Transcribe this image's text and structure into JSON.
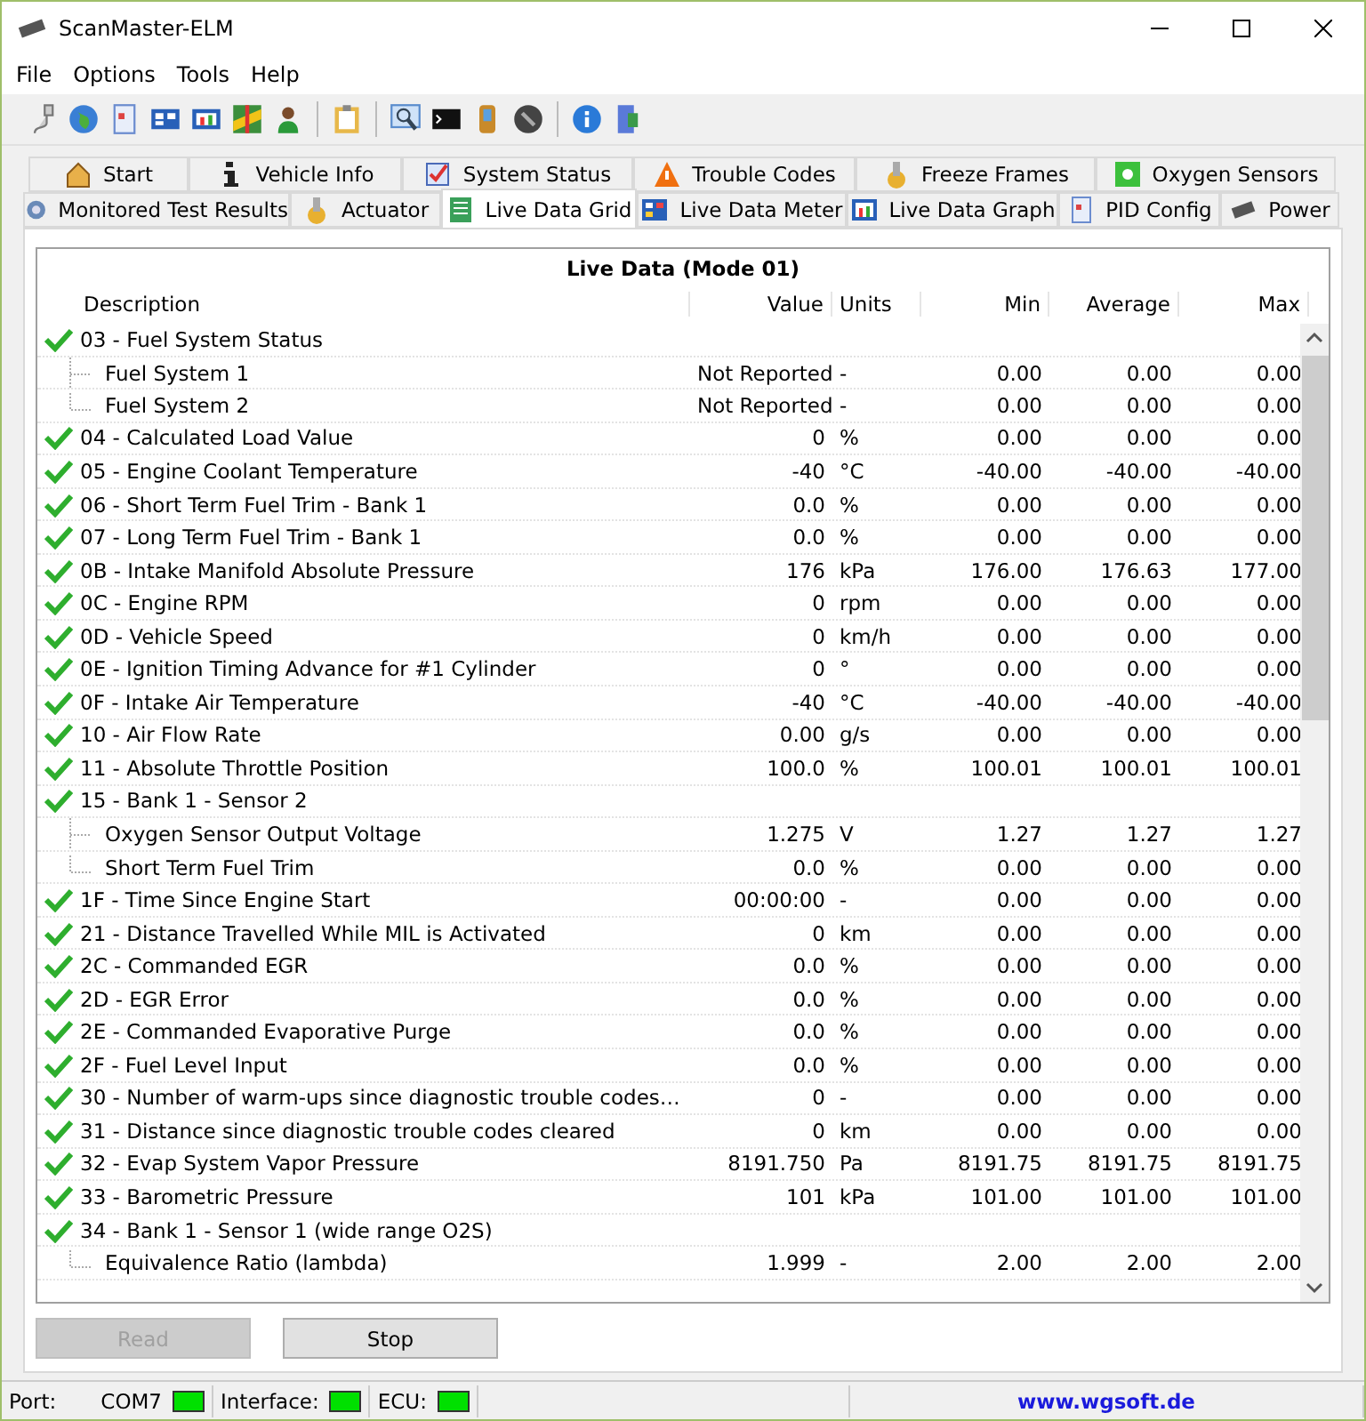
{
  "window": {
    "title": "ScanMaster-ELM"
  },
  "menu": [
    "File",
    "Options",
    "Tools",
    "Help"
  ],
  "tabs_row_1": [
    {
      "label": "Start",
      "selected": false
    },
    {
      "label": "Vehicle Info",
      "selected": false
    },
    {
      "label": "System Status",
      "selected": false
    },
    {
      "label": "Trouble Codes",
      "selected": false
    },
    {
      "label": "Freeze Frames",
      "selected": false
    },
    {
      "label": "Oxygen Sensors",
      "selected": false
    }
  ],
  "tabs_row_2": [
    {
      "label": "Monitored Test Results",
      "selected": false
    },
    {
      "label": "Actuator",
      "selected": false
    },
    {
      "label": "Live Data Grid",
      "selected": true
    },
    {
      "label": "Live Data Meter",
      "selected": false
    },
    {
      "label": "Live Data Graph",
      "selected": false
    },
    {
      "label": "PID Config",
      "selected": false
    },
    {
      "label": "Power",
      "selected": false
    }
  ],
  "grid": {
    "title": "Live Data (Mode 01)",
    "columns": [
      "Description",
      "Value",
      "Units",
      "Min",
      "Average",
      "Max"
    ],
    "rows": [
      {
        "description": "03 - Fuel System Status",
        "checked": true,
        "children": [
          {
            "description": "Fuel System 1",
            "value": "Not Reported",
            "units": "-",
            "min": "0.00",
            "average": "0.00",
            "max": "0.00"
          },
          {
            "description": "Fuel System 2",
            "value": "Not Reported",
            "units": "-",
            "min": "0.00",
            "average": "0.00",
            "max": "0.00"
          }
        ]
      },
      {
        "description": "04 - Calculated Load Value",
        "checked": true,
        "value": "0",
        "units": "%",
        "min": "0.00",
        "average": "0.00",
        "max": "0.00"
      },
      {
        "description": "05 - Engine Coolant Temperature",
        "checked": true,
        "value": "-40",
        "units": "°C",
        "min": "-40.00",
        "average": "-40.00",
        "max": "-40.00"
      },
      {
        "description": "06 - Short Term Fuel Trim - Bank 1",
        "checked": true,
        "value": "0.0",
        "units": "%",
        "min": "0.00",
        "average": "0.00",
        "max": "0.00"
      },
      {
        "description": "07 - Long Term Fuel Trim - Bank 1",
        "checked": true,
        "value": "0.0",
        "units": "%",
        "min": "0.00",
        "average": "0.00",
        "max": "0.00"
      },
      {
        "description": "0B - Intake Manifold Absolute Pressure",
        "checked": true,
        "value": "176",
        "units": "kPa",
        "min": "176.00",
        "average": "176.63",
        "max": "177.00"
      },
      {
        "description": "0C - Engine RPM",
        "checked": true,
        "value": "0",
        "units": "rpm",
        "min": "0.00",
        "average": "0.00",
        "max": "0.00"
      },
      {
        "description": "0D - Vehicle Speed",
        "checked": true,
        "value": "0",
        "units": "km/h",
        "min": "0.00",
        "average": "0.00",
        "max": "0.00"
      },
      {
        "description": "0E - Ignition Timing Advance for #1 Cylinder",
        "checked": true,
        "value": "0",
        "units": "°",
        "min": "0.00",
        "average": "0.00",
        "max": "0.00"
      },
      {
        "description": "0F - Intake Air Temperature",
        "checked": true,
        "value": "-40",
        "units": "°C",
        "min": "-40.00",
        "average": "-40.00",
        "max": "-40.00"
      },
      {
        "description": "10 - Air Flow Rate",
        "checked": true,
        "value": "0.00",
        "units": "g/s",
        "min": "0.00",
        "average": "0.00",
        "max": "0.00"
      },
      {
        "description": "11 - Absolute Throttle Position",
        "checked": true,
        "value": "100.0",
        "units": "%",
        "min": "100.01",
        "average": "100.01",
        "max": "100.01"
      },
      {
        "description": "15 - Bank 1 - Sensor 2",
        "checked": true,
        "children": [
          {
            "description": "Oxygen Sensor Output Voltage",
            "value": "1.275",
            "units": "V",
            "min": "1.27",
            "average": "1.27",
            "max": "1.27"
          },
          {
            "description": "Short Term Fuel Trim",
            "value": "0.0",
            "units": "%",
            "min": "0.00",
            "average": "0.00",
            "max": "0.00"
          }
        ]
      },
      {
        "description": "1F - Time Since Engine Start",
        "checked": true,
        "value": "00:00:00",
        "units": "-",
        "min": "0.00",
        "average": "0.00",
        "max": "0.00"
      },
      {
        "description": "21 - Distance Travelled While MIL is Activated",
        "checked": true,
        "value": "0",
        "units": "km",
        "min": "0.00",
        "average": "0.00",
        "max": "0.00"
      },
      {
        "description": "2C - Commanded EGR",
        "checked": true,
        "value": "0.0",
        "units": "%",
        "min": "0.00",
        "average": "0.00",
        "max": "0.00"
      },
      {
        "description": "2D - EGR Error",
        "checked": true,
        "value": "0.0",
        "units": "%",
        "min": "0.00",
        "average": "0.00",
        "max": "0.00"
      },
      {
        "description": "2E - Commanded Evaporative Purge",
        "checked": true,
        "value": "0.0",
        "units": "%",
        "min": "0.00",
        "average": "0.00",
        "max": "0.00"
      },
      {
        "description": "2F - Fuel Level Input",
        "checked": true,
        "value": "0.0",
        "units": "%",
        "min": "0.00",
        "average": "0.00",
        "max": "0.00"
      },
      {
        "description": "30 - Number of warm-ups since diagnostic trouble codes…",
        "checked": true,
        "value": "0",
        "units": "-",
        "min": "0.00",
        "average": "0.00",
        "max": "0.00"
      },
      {
        "description": "31 - Distance since diagnostic trouble codes cleared",
        "checked": true,
        "value": "0",
        "units": "km",
        "min": "0.00",
        "average": "0.00",
        "max": "0.00"
      },
      {
        "description": "32 - Evap System Vapor Pressure",
        "checked": true,
        "value": "8191.750",
        "units": "Pa",
        "min": "8191.75",
        "average": "8191.75",
        "max": "8191.75"
      },
      {
        "description": "33 - Barometric Pressure",
        "checked": true,
        "value": "101",
        "units": "kPa",
        "min": "101.00",
        "average": "101.00",
        "max": "101.00"
      },
      {
        "description": "34 - Bank 1 - Sensor 1 (wide range O2S)",
        "checked": true,
        "children": [
          {
            "description": "Equivalence Ratio (lambda)",
            "value": "1.999",
            "units": "-",
            "min": "2.00",
            "average": "2.00",
            "max": "2.00"
          }
        ]
      }
    ]
  },
  "buttons": [
    {
      "label": "Read",
      "disabled": true
    },
    {
      "label": "Stop",
      "disabled": false
    }
  ],
  "status_bar": {
    "port_label": "Port:",
    "port": "COM7",
    "port_lit": true,
    "interface_label": "Interface:",
    "interface_lit": true,
    "ecu_label": "ECU:",
    "ecu_lit": true,
    "link": "www.wgsoft.de"
  }
}
